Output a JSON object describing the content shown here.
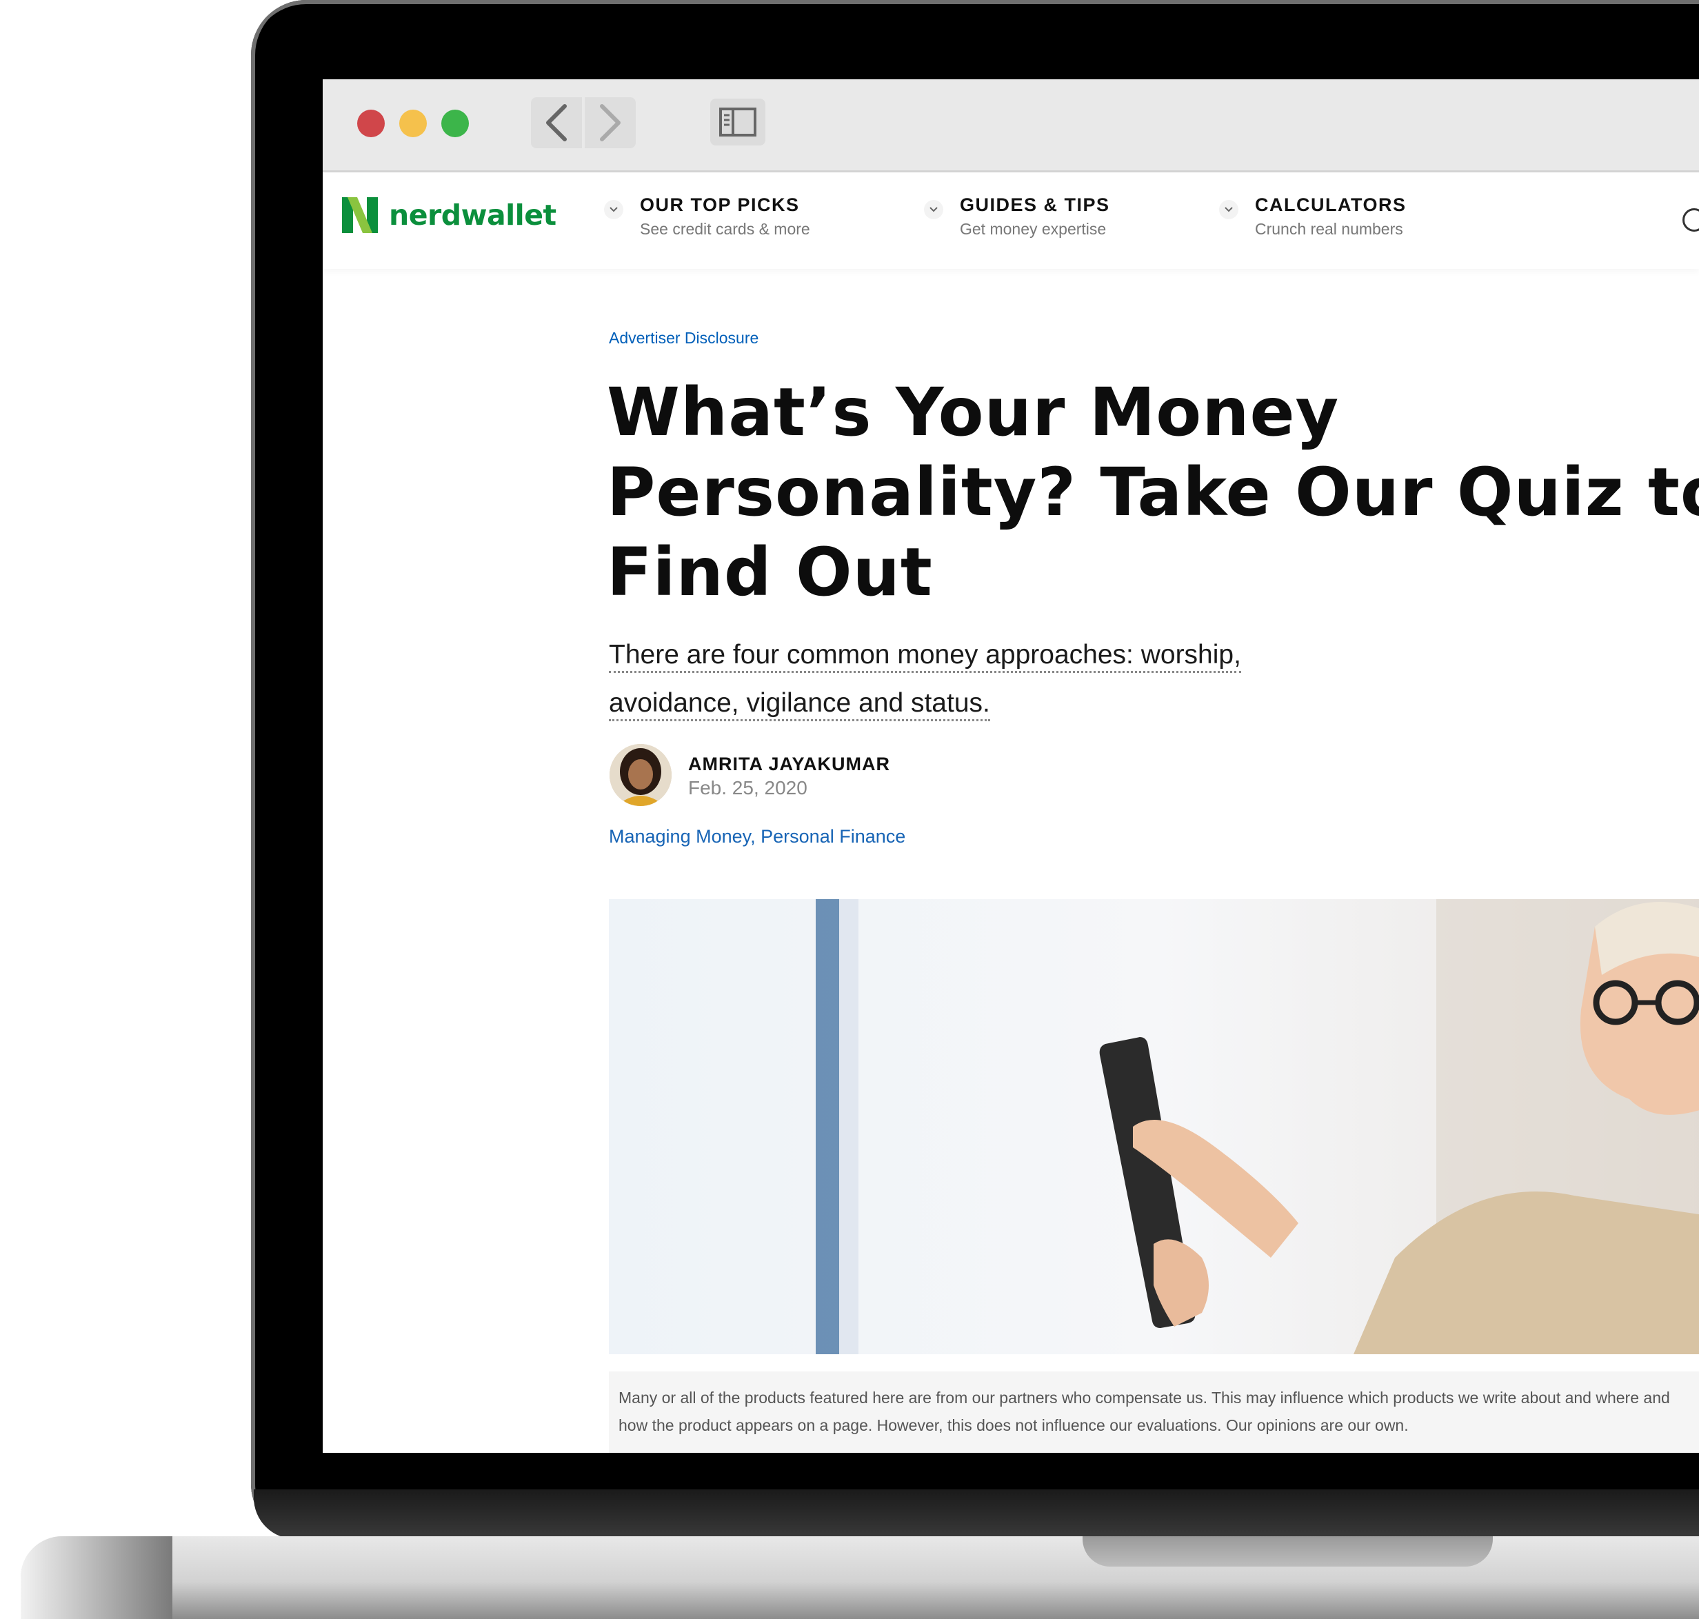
{
  "browser": {
    "icons": [
      "back-icon",
      "forward-icon",
      "sidebar-icon"
    ]
  },
  "site": {
    "logo_text": "nerdwallet",
    "nav": [
      {
        "title": "OUR TOP PICKS",
        "subtitle": "See credit cards & more"
      },
      {
        "title": "GUIDES & TIPS",
        "subtitle": "Get money expertise"
      },
      {
        "title": "CALCULATORS",
        "subtitle": "Crunch real numbers"
      }
    ],
    "brand_color": "#0b8f3c"
  },
  "article": {
    "disclosure": "Advertiser Disclosure",
    "headline": "What’s Your Money Personality? Take Our Quiz to Find Out",
    "subhead": "There are four common money approaches: worship, avoidance, vigilance and status.",
    "author": "AMRITA JAYAKUMAR",
    "date": "Feb. 25, 2020",
    "tags": [
      "Managing Money",
      "Personal Finance"
    ],
    "tag_separator": ", ",
    "disclaimer": "Many or all of the products featured here are from our partners who compensate us. This may influence which products we write about and where and how the product appears on a page. However, this does not influence our evaluations. Our opinions are our own."
  },
  "colors": {
    "link": "#005fb9",
    "traffic_red": "#d0464a",
    "traffic_yellow": "#f5c14c",
    "traffic_green": "#3cb54a"
  }
}
